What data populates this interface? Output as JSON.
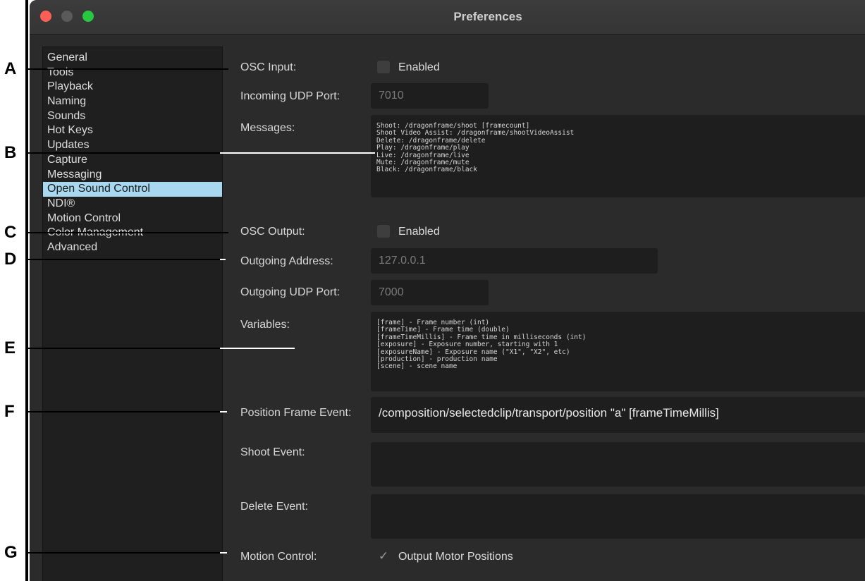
{
  "window": {
    "title": "Preferences"
  },
  "sidebar": {
    "items": [
      {
        "label": "General",
        "selected": false
      },
      {
        "label": "Tools",
        "selected": false
      },
      {
        "label": "Playback",
        "selected": false
      },
      {
        "label": "Naming",
        "selected": false
      },
      {
        "label": "Sounds",
        "selected": false
      },
      {
        "label": "Hot Keys",
        "selected": false
      },
      {
        "label": "Updates",
        "selected": false
      },
      {
        "label": "Capture",
        "selected": false
      },
      {
        "label": "Messaging",
        "selected": false
      },
      {
        "label": "Open Sound Control",
        "selected": true
      },
      {
        "label": "NDI®",
        "selected": false
      },
      {
        "label": "Motion Control",
        "selected": false
      },
      {
        "label": "Color Management",
        "selected": false
      },
      {
        "label": "Advanced",
        "selected": false
      }
    ]
  },
  "form": {
    "osc_input_label": "OSC Input:",
    "osc_input_enabled_label": "Enabled",
    "osc_input_enabled": false,
    "incoming_port_label": "Incoming UDP Port:",
    "incoming_port_placeholder": "7010",
    "messages_label": "Messages:",
    "messages": [
      "Shoot: /dragonframe/shoot [framecount]",
      "Shoot Video Assist: /dragonframe/shootVideoAssist",
      "Delete: /dragonframe/delete",
      "Play: /dragonframe/play",
      "Live: /dragonframe/live",
      "Mute: /dragonframe/mute",
      "Black: /dragonframe/black"
    ],
    "osc_output_label": "OSC Output:",
    "osc_output_enabled_label": "Enabled",
    "osc_output_enabled": false,
    "outgoing_address_label": "Outgoing Address:",
    "outgoing_address_placeholder": "127.0.0.1",
    "outgoing_port_label": "Outgoing UDP Port:",
    "outgoing_port_placeholder": "7000",
    "variables_label": "Variables:",
    "variables": [
      "[frame] - Frame number (int)",
      "[frameTime] - Frame time (double)",
      "[frameTimeMillis] - Frame time in milliseconds (int)",
      "[exposure] - Exposure number, starting with 1",
      "[exposureName] - Exposure name (\"X1\", \"X2\", etc)",
      "[production] - production name",
      "[scene] - scene name"
    ],
    "position_frame_event_label": "Position Frame Event:",
    "position_frame_event_value": "/composition/selectedclip/transport/position \"a\" [frameTimeMillis]",
    "shoot_event_label": "Shoot Event:",
    "shoot_event_value": "",
    "delete_event_label": "Delete Event:",
    "delete_event_value": "",
    "motion_control_label": "Motion Control:",
    "output_motor_positions_label": "Output Motor Positions",
    "output_motor_positions_checked": true
  },
  "callouts": [
    "A",
    "B",
    "C",
    "D",
    "E",
    "F",
    "G"
  ],
  "colors": {
    "selected_item_bg": "#a8d8f0",
    "close_button": "#ff5f57",
    "zoom_button": "#28c840",
    "window_bg": "#2b2b2b"
  }
}
